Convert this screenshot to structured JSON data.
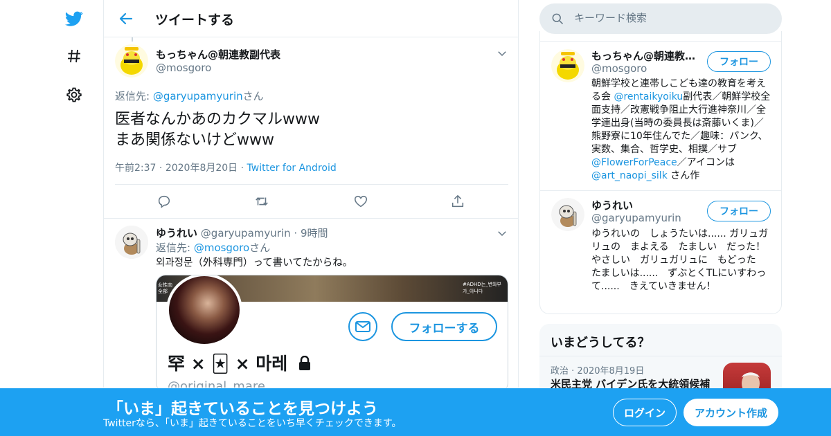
{
  "header": {
    "title": "ツイートする"
  },
  "main_tweet": {
    "author_name": "もっちゃん@朝連教副代表",
    "author_handle": "@mosgoro",
    "reply_prefix": "返信先: ",
    "reply_handle": "@garyupamyurin",
    "reply_suffix": "さん",
    "text_line1": "医者なんかあのカクマルwww",
    "text_line2": "まあ関係ないけどwww",
    "time": "午前2:37",
    "date": "2020年8月20日",
    "source": "Twitter for Android"
  },
  "reply_tweet": {
    "author_name": "ゆうれい",
    "author_handle": "@garyupamyurin",
    "time_ago": "9時間",
    "reply_prefix": "返信先: ",
    "reply_handle": "@mosgoro",
    "reply_suffix": "さん",
    "text": "외과정문（外科専門）って書いてたからね。",
    "card": {
      "banner_text": "#ADHD는_변와부가_아니다",
      "banner_left_text": "女性向\n全部",
      "follow_label": "フォローする",
      "display_name": "罕 × 🃏 × 마레",
      "handle": "@original_mare"
    }
  },
  "search": {
    "placeholder": "キーワード検索"
  },
  "profiles": [
    {
      "name": "もっちゃん@朝連教…",
      "handle": "@mosgoro",
      "follow_label": "フォロー",
      "bio_parts": [
        {
          "text": "朝鮮学校と連帯しこども達の教育を考える会 ",
          "link": false
        },
        {
          "text": "@rentaikyoiku",
          "link": true
        },
        {
          "text": "副代表／朝鮮学校全面支持／改憲戦争阻止大行進神奈川／全学連出身(当時の委員長は斎藤いくま)／熊野寮に10年住んでた／趣味：パンク、実数、集合、哲学史、相撲／サブ",
          "link": false
        },
        {
          "text": "@FlowerForPeace",
          "link": true
        },
        {
          "text": "／アイコンは ",
          "link": false
        },
        {
          "text": "@art_naopi_silk",
          "link": true
        },
        {
          "text": " さん作",
          "link": false
        }
      ]
    },
    {
      "name": "ゆうれい",
      "handle": "@garyupamyurin",
      "follow_label": "フォロー",
      "bio": "ゆうれいの　しょうたいは...... ガリュガリュの　まよえる　たましい　だった！ やさしい　ガリュガリュに　もどった　たましいは......　ずぶとくTLにいすわって......　きえていきません！"
    }
  ],
  "trends": {
    "title": "いまどうしてる？",
    "item": {
      "category": "政治",
      "date": "2020年8月19日",
      "headline": "米民主党 バイデン氏を大統領候補"
    }
  },
  "bottom_bar": {
    "headline": "「いま」起きていることを見つけよう",
    "subtext": "Twitterなら、「いま」起きていることをいち早くチェックできます。",
    "login_label": "ログイン",
    "signup_label": "アカウント作成"
  },
  "colors": {
    "accent": "#1b95e0",
    "bar": "#1da1f2",
    "text": "#14171a",
    "muted": "#657786"
  },
  "icons": [
    "twitter-bird-icon",
    "hashtag-icon",
    "gear-icon",
    "back-arrow-icon",
    "chevron-down-icon",
    "reply-icon",
    "retweet-icon",
    "like-icon",
    "share-icon",
    "search-icon",
    "mail-icon",
    "lock-icon"
  ]
}
